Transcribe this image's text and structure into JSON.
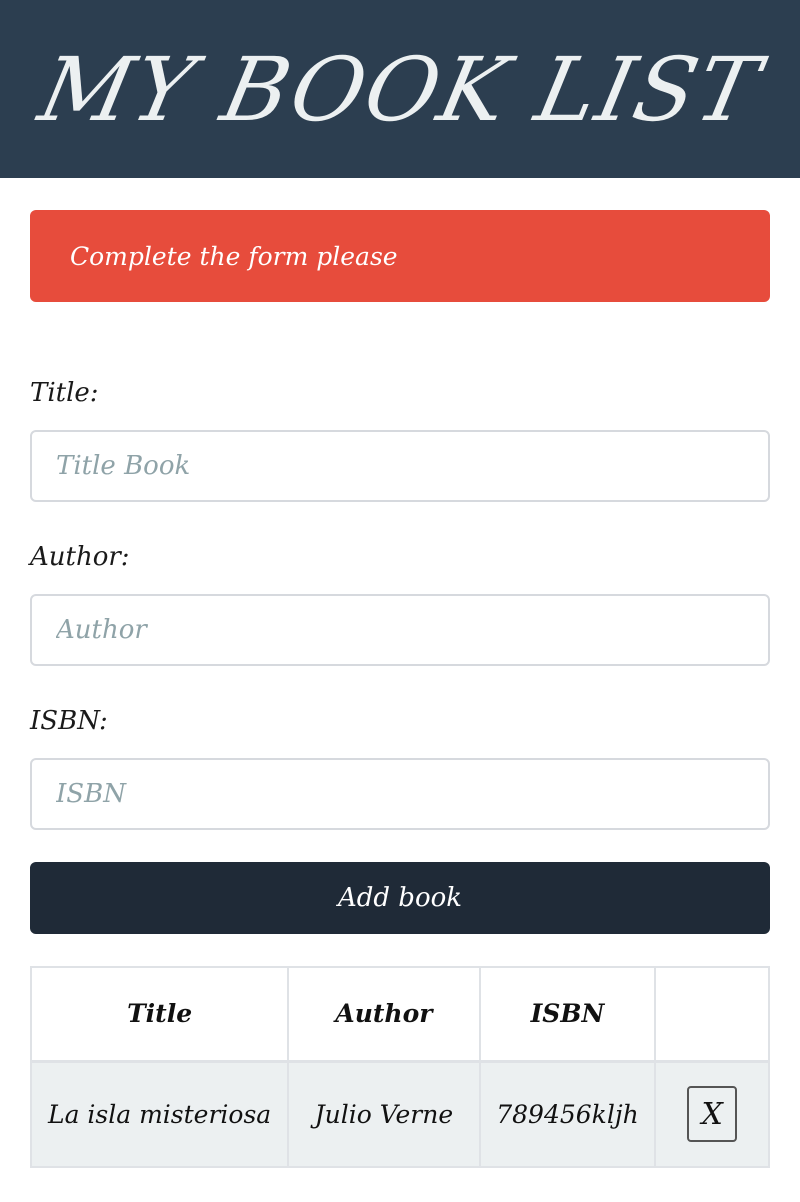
{
  "header": {
    "title": "MY BOOK LIST"
  },
  "alert": {
    "message": "Complete the form please",
    "color": "#e74c3c"
  },
  "form": {
    "title_label": "Title:",
    "title_placeholder": "Title Book",
    "author_label": "Author:",
    "author_placeholder": "Author",
    "isbn_label": "ISBN:",
    "isbn_placeholder": "ISBN",
    "submit_label": "Add book"
  },
  "table": {
    "headers": [
      "Title",
      "Author",
      "ISBN",
      ""
    ],
    "rows": [
      {
        "title": "La isla misteriosa",
        "author": "Julio Verne",
        "isbn": "789456kljh",
        "delete_label": "X"
      }
    ]
  },
  "colors": {
    "header_bg": "#2c3e50",
    "button_bg": "#1f2a37",
    "row_bg": "#ecf0f1"
  }
}
